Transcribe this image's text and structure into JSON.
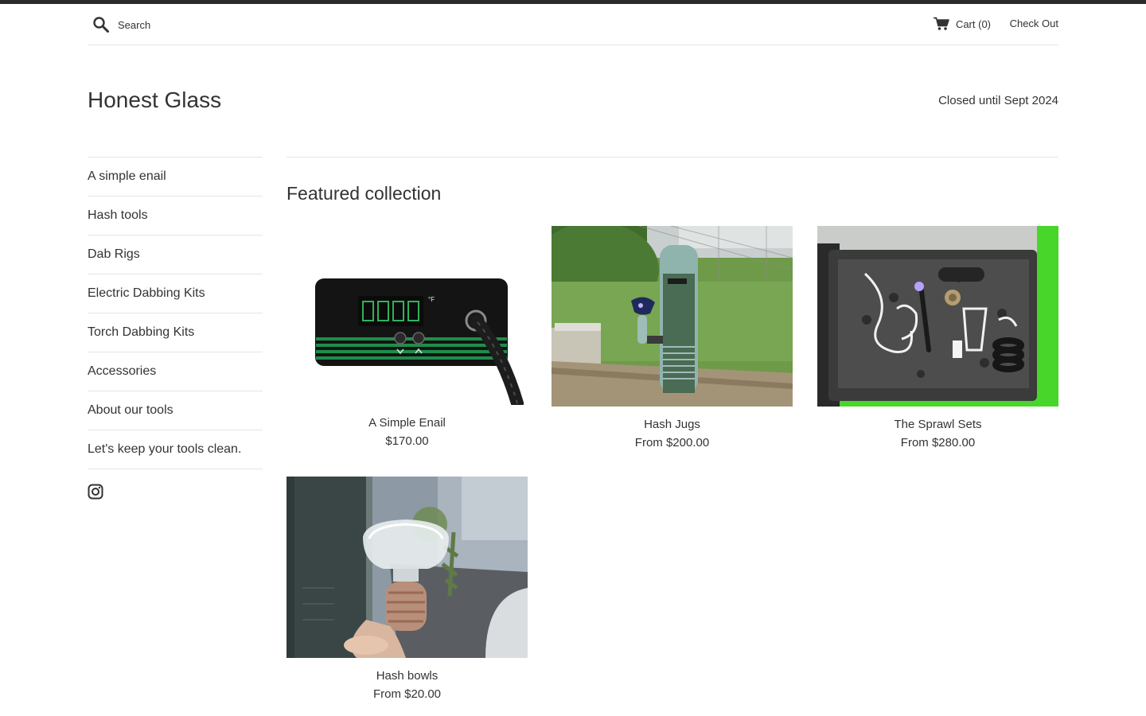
{
  "header": {
    "search_placeholder": "Search",
    "search_icon": "search-icon",
    "cart_icon": "cart-icon",
    "cart_label": "Cart (0)",
    "checkout_label": "Check Out"
  },
  "site": {
    "title": "Honest Glass",
    "status": "Closed until Sept 2024"
  },
  "sidebar": {
    "items": [
      {
        "label": "A simple enail"
      },
      {
        "label": "Hash tools"
      },
      {
        "label": "Dab Rigs"
      },
      {
        "label": "Electric Dabbing Kits"
      },
      {
        "label": "Torch Dabbing Kits"
      },
      {
        "label": "Accessories"
      },
      {
        "label": "About our tools"
      },
      {
        "label": "Let's keep your tools clean."
      }
    ],
    "social_icon": "instagram-icon"
  },
  "main": {
    "section_title": "Featured collection",
    "products": [
      {
        "title": "A Simple Enail",
        "price": "$170.00"
      },
      {
        "title": "Hash Jugs",
        "price": "From $200.00"
      },
      {
        "title": "The Sprawl Sets",
        "price": "From $280.00"
      },
      {
        "title": "Hash bowls",
        "price": "From $20.00"
      }
    ]
  },
  "colors": {
    "top_bar": "#2b2b2b",
    "text": "#333333",
    "divider": "#e5e5e5",
    "case_green": "#49d62a"
  }
}
